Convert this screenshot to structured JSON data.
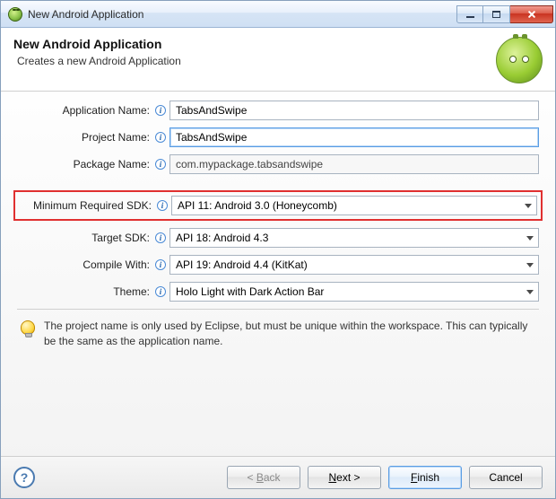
{
  "window": {
    "title": "New Android Application"
  },
  "header": {
    "title": "New Android Application",
    "subtitle": "Creates a new Android Application"
  },
  "fields": {
    "app_name": {
      "label": "Application Name:",
      "value": "TabsAndSwipe"
    },
    "proj_name": {
      "label": "Project Name:",
      "value": "TabsAndSwipe"
    },
    "pkg_name": {
      "label": "Package Name:",
      "value": "com.mypackage.tabsandswipe"
    },
    "min_sdk": {
      "label": "Minimum Required SDK:",
      "value": "API 11: Android 3.0 (Honeycomb)"
    },
    "target_sdk": {
      "label": "Target SDK:",
      "value": "API 18: Android 4.3"
    },
    "compile": {
      "label": "Compile With:",
      "value": "API 19: Android 4.4 (KitKat)"
    },
    "theme": {
      "label": "Theme:",
      "value": "Holo Light with Dark Action Bar"
    }
  },
  "note": "The project name is only used by Eclipse, but must be unique within the workspace. This can typically be the same as the application name.",
  "buttons": {
    "back": "< Back",
    "next": "Next >",
    "finish": "Finish",
    "cancel": "Cancel"
  }
}
